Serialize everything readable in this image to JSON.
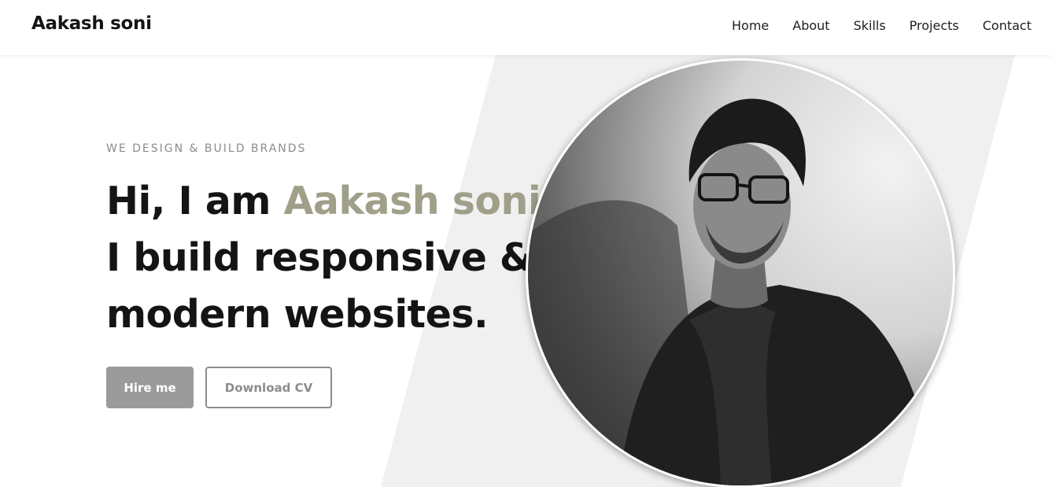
{
  "header": {
    "brand": "Aakash soni",
    "nav": [
      "Home",
      "About",
      "Skills",
      "Projects",
      "Contact"
    ]
  },
  "hero": {
    "tagline": "WE DESIGN & BUILD BRANDS",
    "greeting": "Hi, I am ",
    "name": "Aakash soni",
    "line2": "I build responsive &",
    "line3": "modern websites.",
    "hire_label": "Hire me",
    "cv_label": "Download CV"
  },
  "colors": {
    "accent": "#a09f89",
    "hire_button": "#9b9b9b",
    "shape_bg": "#f0f0f0"
  }
}
